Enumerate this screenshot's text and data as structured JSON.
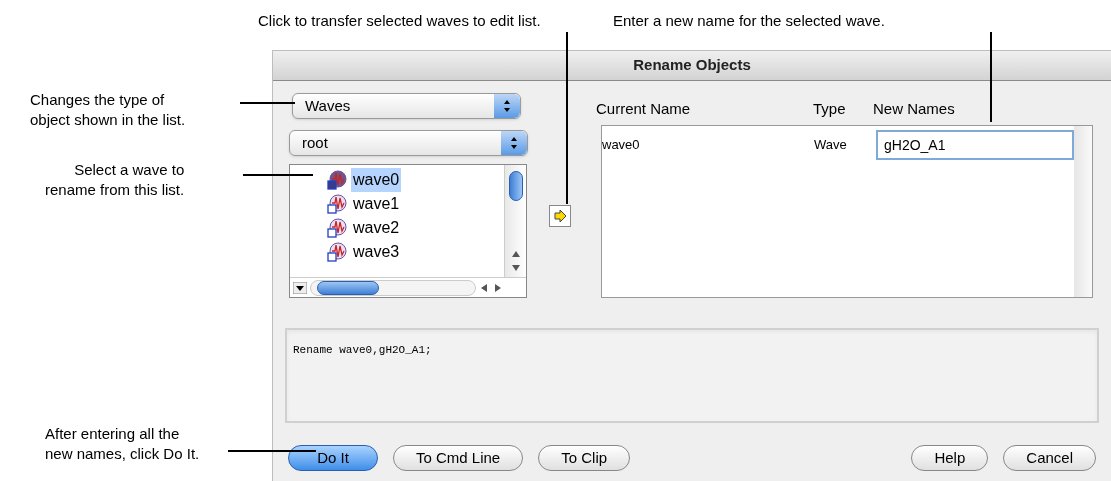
{
  "top_callouts": [
    {
      "text": "Click to transfer selected waves to edit list."
    },
    {
      "text": "Enter a new name for the selected wave."
    }
  ],
  "left_callouts": [
    {
      "lines": [
        "Changes the type of",
        "object shown in the list."
      ]
    },
    {
      "lines": [
        "Select a wave to",
        "rename from this list."
      ]
    },
    {
      "lines": [
        "After entering all the",
        "new names, click Do It."
      ]
    }
  ],
  "dialog": {
    "title": "Rename Objects",
    "type_popup": {
      "value": "Waves"
    },
    "folder_popup": {
      "value": "root"
    },
    "wave_list": [
      {
        "name": "wave0",
        "selected": true
      },
      {
        "name": "wave1",
        "selected": false
      },
      {
        "name": "wave2",
        "selected": false
      },
      {
        "name": "wave3",
        "selected": false
      }
    ],
    "table": {
      "columns": [
        "Current Name",
        "Type",
        "New Names"
      ],
      "rows": [
        {
          "current_name": "wave0",
          "type": "Wave",
          "new_name": "gH2O_A1"
        }
      ]
    },
    "command": "Rename wave0,gH2O_A1;",
    "left_buttons": [
      {
        "label": "Do It",
        "default": true
      },
      {
        "label": "To Cmd Line",
        "default": false
      },
      {
        "label": "To Clip",
        "default": false
      }
    ],
    "right_buttons": [
      {
        "label": "Help",
        "default": false
      },
      {
        "label": "Cancel",
        "default": false
      }
    ]
  }
}
